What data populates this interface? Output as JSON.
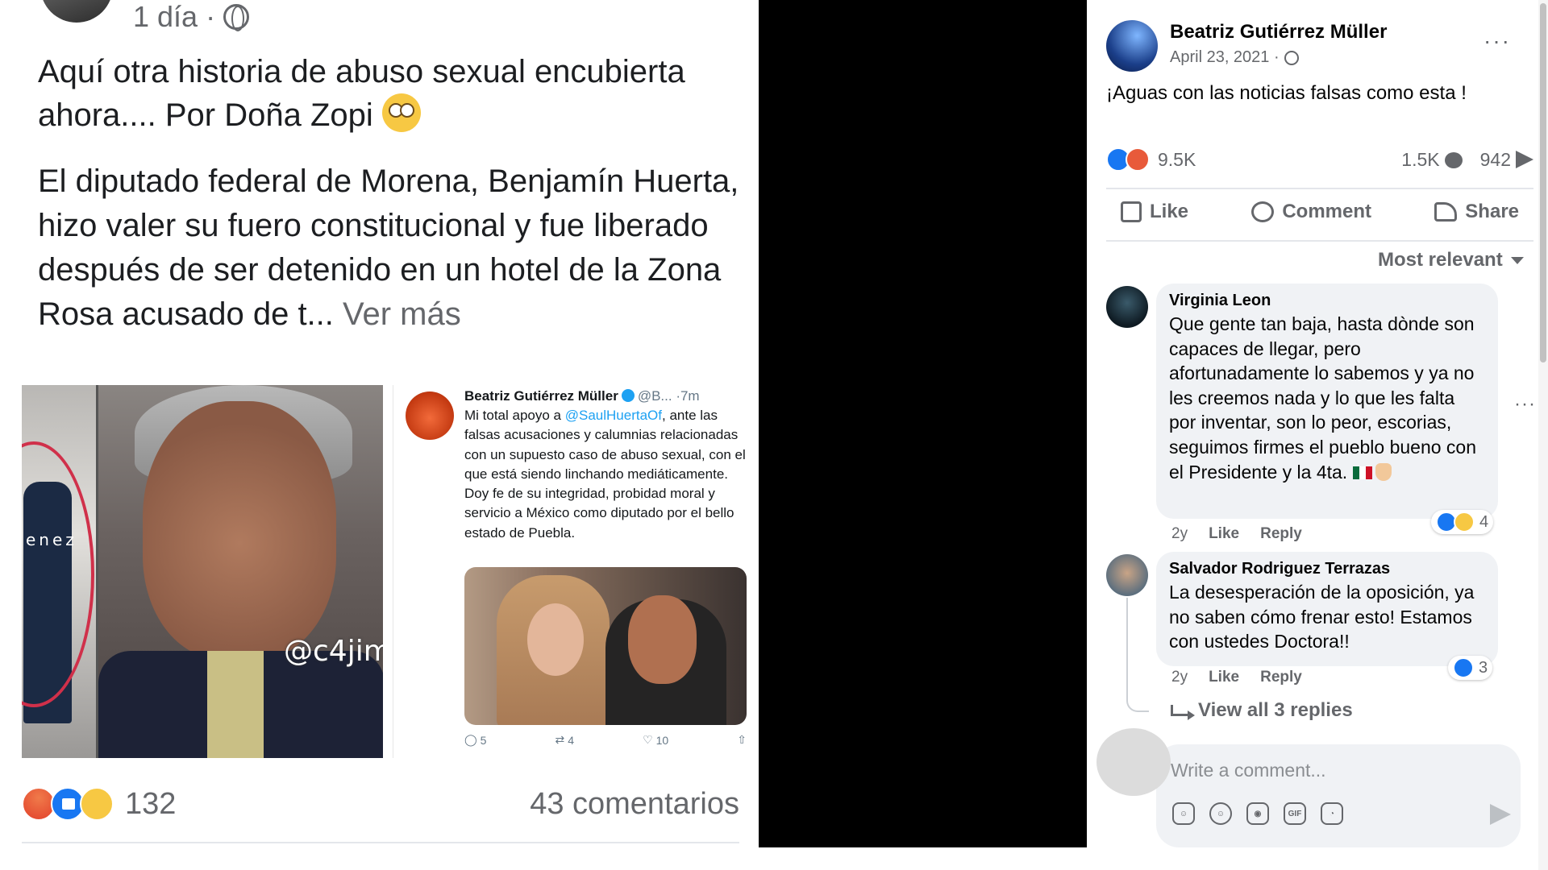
{
  "left_post": {
    "meta_time": "1 día ·",
    "intro_line": "Aquí otra historia de abuso sexual encubierta ahora.... Por Doña Zopi",
    "body_text": "El diputado federal de Morena, Benjamín Huerta, hizo valer su fuero constitucional y fue liberado después de ser detenido en un hotel de la Zona Rosa acusado de t...",
    "see_more": "Ver más",
    "photo_banner_text": "enez",
    "photo_watermark": "@c4jim",
    "tweet": {
      "author": "Beatriz Gutiérrez Müller",
      "handle": "@B... ·7m",
      "body_pre": "Mi total apoyo a ",
      "mention": "@SaulHuertaOf",
      "body_post": ", ante las falsas acusaciones y calumnias relacionadas con un supuesto caso de abuso sexual, con el que está siendo linchando mediáticamente. Doy fe de su integridad, probidad moral y servicio a México como diputado por el bello estado de Puebla.",
      "replies": "5",
      "retweets": "4",
      "likes": "10"
    },
    "reaction_count": "132",
    "comments_count": "43 comentarios"
  },
  "right_post": {
    "author": "Beatriz Gutiérrez Müller",
    "date": "April 23, 2021 ·",
    "more": "···",
    "text": "¡Aguas con las noticias falsas como esta !",
    "reactions": "9.5K",
    "comments": "1.5K",
    "shares": "942",
    "actions": {
      "like": "Like",
      "comment": "Comment",
      "share": "Share"
    },
    "sort": "Most relevant",
    "comments_list": [
      {
        "name": "Virginia Leon",
        "text": "Que gente tan baja, hasta dònde son capaces de llegar, pero afortunadamente lo sabemos y ya no les creemos nada y lo que les falta por inventar, son lo peor, escorias, seguimos firmes el pueblo bueno con el Presidente y la 4ta.",
        "time": "2y",
        "like": "Like",
        "reply": "Reply",
        "reaction_count": "4"
      },
      {
        "name": "Salvador Rodriguez Terrazas",
        "text": "La desesperación de la oposición, ya no saben cómo frenar esto! Estamos con ustedes Doctora!!",
        "time": "2y",
        "like": "Like",
        "reply": "Reply",
        "reaction_count": "3"
      }
    ],
    "comment_more": "···",
    "view_replies": "View all 3 replies",
    "write_placeholder": "Write a comment...",
    "gif_label": "GIF"
  }
}
